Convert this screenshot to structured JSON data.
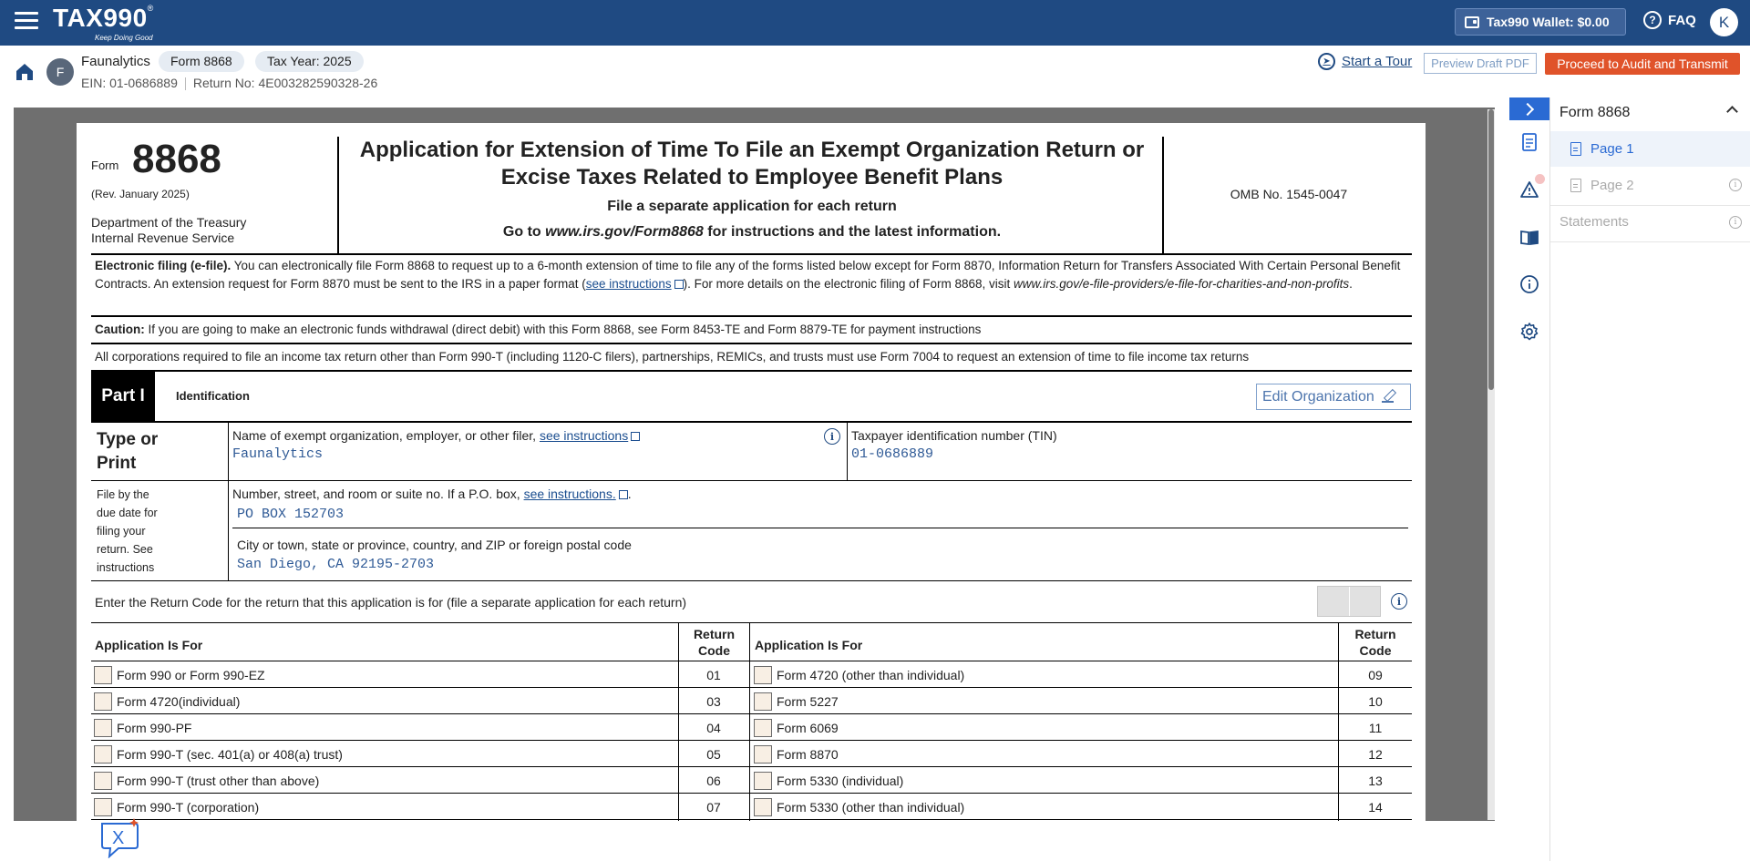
{
  "app": {
    "logo": "TAX990",
    "logo_reg": "®",
    "tagline": "Keep Doing Good",
    "wallet_label": "Tax990 Wallet: $0.00",
    "faq_label": "FAQ",
    "user_initial": "K"
  },
  "subheader": {
    "org_initial": "F",
    "org_name": "Faunalytics",
    "form_chip": "Form 8868",
    "year_chip": "Tax Year: 2025",
    "ein": "EIN: 01-0686889",
    "return_no": "Return No: 4E003282590328-26",
    "tour_label": "Start a Tour",
    "preview_label": "Preview Draft PDF",
    "proceed_label": "Proceed to Audit and Transmit"
  },
  "form": {
    "form_word": "Form",
    "number": "8868",
    "rev": "(Rev. January 2025)",
    "dept_line1": "Department of the Treasury",
    "dept_line2": "Internal Revenue Service",
    "title_line1": "Application for Extension of Time To File an Exempt Organization Return or",
    "title_line2": "Excise Taxes Related to Employee Benefit Plans",
    "sub1": "File a separate application for each return",
    "sub2_pre": "Go to ",
    "sub2_url": "www.irs.gov/Form8868",
    "sub2_post": " for instructions and the latest information.",
    "omb": "OMB No. 1545-0047",
    "efile_bold": "Electronic filing (e-file).",
    "efile_text1": " You can electronically file Form 8868 to request up to a 6-month extension of time to file any of the forms listed below except for Form 8870, Information Return for Transfers Associated With Certain Personal Benefit Contracts. An extension request for Form 8870 must be sent to the IRS in a paper format (",
    "efile_link": "see instructions",
    "efile_text2": "). For more details on the electronic filing of Form 8868, visit ",
    "efile_url": "www.irs.gov/e-file-providers/e-file-for-charities-and-non-profits",
    "efile_text3": ".",
    "caution_bold": "Caution:",
    "caution_text": " If you are going to make an electronic funds withdrawal (direct debit) with this Form 8868, see Form 8453-TE and Form 8879-TE for payment instructions",
    "corp_text": "All corporations required to file an income tax return other than Form 990-T (including 1120-C filers), partnerships, REMICs, and trusts must use Form 7004 to request an extension of time to file income tax returns",
    "part_label": "Part I",
    "part_title": "Identification",
    "edit_org_label": "Edit Organization",
    "type_print_1": "Type or",
    "type_print_2": "Print",
    "file_by": [
      "File by the",
      "due date for",
      "filing your",
      "return. See",
      "instructions"
    ],
    "name_label": "Name of exempt organization, employer, or other filer, ",
    "name_link": "see instructions",
    "name_value": "Faunalytics",
    "tin_label": "Taxpayer identification number (TIN)",
    "tin_value": "01-0686889",
    "street_label": "Number, street, and room or suite no. If a P.O. box, ",
    "street_link": "see instructions.",
    "street_post": ".",
    "street_value": "PO BOX 152703",
    "city_label": "City or town, state or province, country, and ZIP or foreign postal code",
    "city_value": "San Diego, CA 92195-2703",
    "return_code_label": "Enter the Return Code for the return that this application is for (file a separate application for each return)",
    "table": {
      "col_app": "Application Is For",
      "col_code_1": "Return",
      "col_code_2": "Code",
      "left_rows": [
        {
          "label": "Form 990 or Form 990-EZ",
          "code": "01"
        },
        {
          "label": "Form 4720(individual)",
          "code": "03"
        },
        {
          "label": "Form 990-PF",
          "code": "04"
        },
        {
          "label": "Form 990-T (sec. 401(a) or 408(a) trust)",
          "code": "05"
        },
        {
          "label": "Form 990-T (trust other than above)",
          "code": "06"
        },
        {
          "label": "Form 990-T (corporation)",
          "code": "07"
        }
      ],
      "right_rows": [
        {
          "label": "Form 4720 (other than individual)",
          "code": "09"
        },
        {
          "label": "Form 5227",
          "code": "10"
        },
        {
          "label": "Form 6069",
          "code": "11"
        },
        {
          "label": "Form 8870",
          "code": "12"
        },
        {
          "label": "Form 5330 (individual)",
          "code": "13"
        },
        {
          "label": "Form 5330 (other than individual)",
          "code": "14"
        }
      ]
    }
  },
  "sidebar": {
    "panel_title": "Form 8868",
    "pages": [
      {
        "label": "Page 1"
      },
      {
        "label": "Page 2"
      }
    ],
    "statements": "Statements"
  }
}
